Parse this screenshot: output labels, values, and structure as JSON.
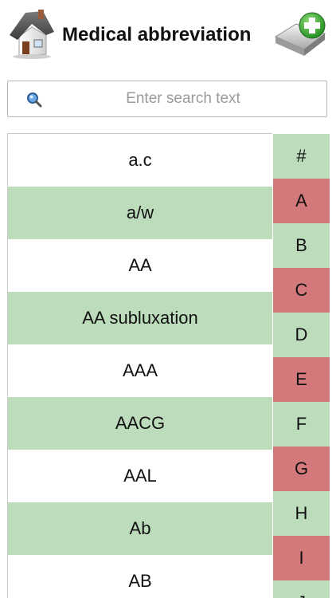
{
  "header": {
    "title": "Medical abbreviation",
    "home_icon": "home-icon",
    "add_icon": "add-folder-icon"
  },
  "search": {
    "placeholder": "Enter search text",
    "value": "",
    "icon": "search-icon"
  },
  "list": {
    "items": [
      {
        "label": "a.c",
        "highlight": false
      },
      {
        "label": "a/w",
        "highlight": true
      },
      {
        "label": "AA",
        "highlight": false
      },
      {
        "label": "AA subluxation",
        "highlight": true
      },
      {
        "label": "AAA",
        "highlight": false
      },
      {
        "label": "AACG",
        "highlight": true
      },
      {
        "label": "AAL",
        "highlight": false
      },
      {
        "label": "Ab",
        "highlight": true
      },
      {
        "label": "AB",
        "highlight": false
      }
    ]
  },
  "index": {
    "letters": [
      {
        "label": "#",
        "color": "#bcdcbc"
      },
      {
        "label": "A",
        "color": "#d4797b"
      },
      {
        "label": "B",
        "color": "#bcdcbc"
      },
      {
        "label": "C",
        "color": "#d4797b"
      },
      {
        "label": "D",
        "color": "#bcdcbc"
      },
      {
        "label": "E",
        "color": "#d4797b"
      },
      {
        "label": "F",
        "color": "#bcdcbc"
      },
      {
        "label": "G",
        "color": "#d4797b"
      },
      {
        "label": "H",
        "color": "#bcdcbc"
      },
      {
        "label": "I",
        "color": "#d4797b"
      },
      {
        "label": "J",
        "color": "#bcdcbc"
      }
    ]
  },
  "colors": {
    "row_green": "#bcdcbc",
    "index_green": "#bcdcbc",
    "index_red": "#d4797b"
  }
}
